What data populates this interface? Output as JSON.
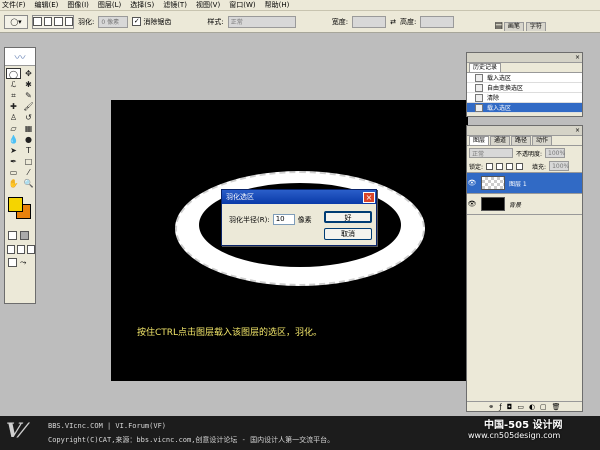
{
  "menu": [
    "文件(F)",
    "编辑(E)",
    "图像(I)",
    "图层(L)",
    "选择(S)",
    "滤镜(T)",
    "视图(V)",
    "窗口(W)",
    "帮助(H)"
  ],
  "options": {
    "feather_label": "羽化:",
    "feather_value": "0 像素",
    "antialias_label": "消除锯齿",
    "style_label": "样式:",
    "style_value": "正常",
    "width_label": "宽度:",
    "height_label": "高度:",
    "tabs": [
      "画笔",
      "字符"
    ]
  },
  "history": {
    "tabs": [
      "历史记录"
    ],
    "items": [
      {
        "label": "载入选区",
        "selected": false
      },
      {
        "label": "自由变换选区",
        "selected": false
      },
      {
        "label": "清除",
        "selected": false
      },
      {
        "label": "载入选区",
        "selected": true
      }
    ]
  },
  "layers": {
    "tabs": [
      "图层",
      "通道",
      "路径",
      "动作"
    ],
    "blend_mode": "正常",
    "opacity_label": "不透明度:",
    "opacity_value": "100%",
    "lock_label": "锁定:",
    "fill_label": "填充:",
    "fill_value": "100%",
    "items": [
      {
        "name": "图层 1",
        "selected": true
      },
      {
        "name": "背景",
        "selected": false
      }
    ]
  },
  "dialog": {
    "title": "羽化选区",
    "radius_label": "羽化半径(R):",
    "radius_value": "10",
    "unit": "像素",
    "ok_label": "好",
    "cancel_label": "取消"
  },
  "canvas_hint": "按住CTRL点击图层载入该图层的选区，羽化。",
  "footer": {
    "line1": "BBS.VIcnc.COM  |  VI.Forum(VF)",
    "line2": "Copyright(C)CAT,来源：bbs.vicnc.com,创意设计论坛 - 国内设计人第一交流平台。"
  },
  "watermark": {
    "line1": "中国-505 设计网",
    "line2": "www.cn505design.com"
  },
  "colors": {
    "foreground": "#f5d400",
    "background": "#e8820c",
    "selection": "#316ac5"
  }
}
